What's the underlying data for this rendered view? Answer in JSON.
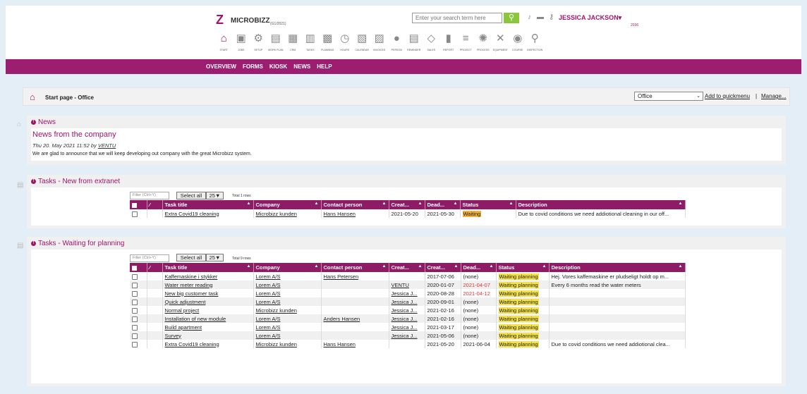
{
  "brand": {
    "logo_glyph": "Z",
    "name": "MICROBIZZ",
    "version": "(G1/2021)"
  },
  "search": {
    "placeholder": "Enter your search term here"
  },
  "topicons": [
    "bell-icon",
    "chat-icon",
    "key-icon"
  ],
  "user": {
    "name": "JESSICA JACKSON▾",
    "sub": "2036"
  },
  "nav": [
    {
      "label": "START",
      "glyph": "⌂"
    },
    {
      "label": "JOBS",
      "glyph": "▣"
    },
    {
      "label": "SETUP",
      "glyph": "⚙"
    },
    {
      "label": "WORK PLAN",
      "glyph": "▤"
    },
    {
      "label": "CRM",
      "glyph": "▦"
    },
    {
      "label": "TASKS",
      "glyph": "▥"
    },
    {
      "label": "PLANNING",
      "glyph": "▩"
    },
    {
      "label": "HOURS",
      "glyph": "◷"
    },
    {
      "label": "CALENDAR",
      "glyph": "▧"
    },
    {
      "label": "INVOICES",
      "glyph": "▨"
    },
    {
      "label": "PERSON",
      "glyph": "●"
    },
    {
      "label": "REMINDER",
      "glyph": "▤"
    },
    {
      "label": "SALES",
      "glyph": "◇"
    },
    {
      "label": "REPORT",
      "glyph": "▮"
    },
    {
      "label": "PROJECT",
      "glyph": "≡"
    },
    {
      "label": "PROCESS",
      "glyph": "✺"
    },
    {
      "label": "EQUIPMENT",
      "glyph": "✕"
    },
    {
      "label": "COURSE",
      "glyph": "◉"
    },
    {
      "label": "INSPECTION",
      "glyph": "⚲"
    }
  ],
  "menubar": [
    "OVERVIEW",
    "FORMS",
    "KIOSK",
    "NEWS",
    "HELP"
  ],
  "crumb": {
    "title": "Start page - Office",
    "select": "Office",
    "quick": "Add to quickmenu",
    "sep": "|",
    "manage": "Manage..."
  },
  "news": {
    "header": "News",
    "title": "News from the company",
    "meta_pre": "Thu 20. May 2021 11:52 by ",
    "meta_user": "VENTU",
    "text": "We are glad to announce that we will keep developing out company with the great Microbizz system."
  },
  "colors": {
    "accent": "#9d1d71",
    "search_button": "#8cc63f",
    "status_waiting": "#f0b23c",
    "status_planning": "#f3e14a"
  },
  "tasks1": {
    "header": "Tasks - New from extranet",
    "filter": "Filter (Ctrl+Y)",
    "select_all": "Select all",
    "page_size": "25▼",
    "total": "Total 1 rows",
    "columns": [
      "",
      "",
      "Task title",
      "Company",
      "Contact person",
      "Creat...",
      "Dead...",
      "Status",
      "Description"
    ],
    "rows": [
      {
        "title": "Extra Covid19 cleaning",
        "company": "Microbizz kunden",
        "contact": "Hans Hansen",
        "created": "2021-05-20",
        "deadline": "2021-05-30",
        "status": "Waiting",
        "description": "Due to covid conditions we need addiotional cleaning in our off..."
      }
    ]
  },
  "tasks2": {
    "header": "Tasks - Waiting for planning",
    "filter": "Filter (Ctrl+Y)",
    "select_all": "Select all",
    "page_size": "25▼",
    "total": "Total 9 rows",
    "columns": [
      "",
      "",
      "Task title",
      "Company",
      "Contact person",
      "Creat...",
      "Creat...",
      "Dead...",
      "Status",
      "Description"
    ],
    "rows": [
      {
        "title": "Kaffemaskine i stykker",
        "company": "Lorem A/S",
        "contact": "Hans Petersen",
        "creator": "",
        "created": "2017-07-06",
        "deadline": "(none)",
        "status": "Waiting planning",
        "description": "Hej. Vores kaffemaskine er pludseligt holdt op m..."
      },
      {
        "title": "Water meter reading",
        "company": "Lorem A/S",
        "contact": "",
        "creator": "VENTU",
        "created": "2020-01-07",
        "deadline": "2021-04-07",
        "status": "Waiting planning",
        "description": "Every 6 months read the water meters"
      },
      {
        "title": "New big customer task",
        "company": "Lorem A/S",
        "contact": "",
        "creator": "Jessica J...",
        "created": "2020-08-28",
        "deadline": "2021-04-12",
        "status": "Waiting planning",
        "description": ""
      },
      {
        "title": "Quick adjustment",
        "company": "Lorem A/S",
        "contact": "",
        "creator": "Jessica J...",
        "created": "2020-09-01",
        "deadline": "(none)",
        "status": "Waiting planning",
        "description": ""
      },
      {
        "title": "Normal project",
        "company": "Microbizz kunden",
        "contact": "",
        "creator": "Jessica J...",
        "created": "2021-02-16",
        "deadline": "(none)",
        "status": "Waiting planning",
        "description": ""
      },
      {
        "title": "Installation of new module",
        "company": "Lorem A/S",
        "contact": "Anders Hansen",
        "creator": "Jessica J...",
        "created": "2021-02-16",
        "deadline": "(none)",
        "status": "Waiting planning",
        "description": ""
      },
      {
        "title": "Build apartment",
        "company": "Lorem A/S",
        "contact": "",
        "creator": "Jessica J...",
        "created": "2021-03-17",
        "deadline": "(none)",
        "status": "Waiting planning",
        "description": ""
      },
      {
        "title": "Survey",
        "company": "Lorem A/S",
        "contact": "",
        "creator": "Jessica J...",
        "created": "2021-05-06",
        "deadline": "(none)",
        "status": "Waiting planning",
        "description": ""
      },
      {
        "title": "Extra Covid19 cleaning",
        "company": "Microbizz kunden",
        "contact": "Hans Hansen",
        "creator": "",
        "created": "2021-05-20",
        "deadline": "2021-06-04",
        "status": "Waiting planning",
        "description": "Due to covid conditions we need addiotional clea..."
      }
    ]
  }
}
